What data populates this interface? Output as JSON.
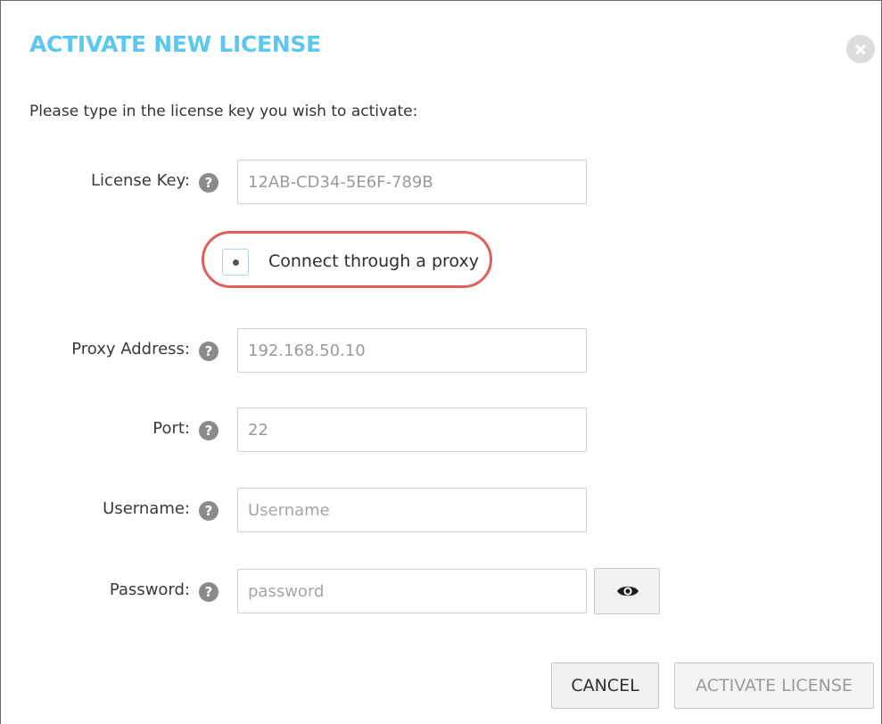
{
  "dialog": {
    "title": "ACTIVATE NEW LICENSE",
    "intro": "Please type in the license key you wish to activate:"
  },
  "fields": {
    "license_key": {
      "label": "License Key:",
      "value": "12AB-CD34-5E6F-789B"
    },
    "proxy_address": {
      "label": "Proxy Address:",
      "value": "192.168.50.10"
    },
    "port": {
      "label": "Port:",
      "value": "22"
    },
    "username": {
      "label": "Username:",
      "placeholder": "Username"
    },
    "password": {
      "label": "Password:",
      "placeholder": "password"
    }
  },
  "proxy": {
    "label": "Connect through a proxy",
    "checked": true
  },
  "help_glyph": "?",
  "buttons": {
    "cancel": "CANCEL",
    "activate": "ACTIVATE LICENSE"
  },
  "colors": {
    "title": "#5cc8f0",
    "highlight": "#e0605c"
  },
  "icons": {
    "close": "close-icon",
    "help": "help-icon",
    "eye": "eye-icon"
  }
}
